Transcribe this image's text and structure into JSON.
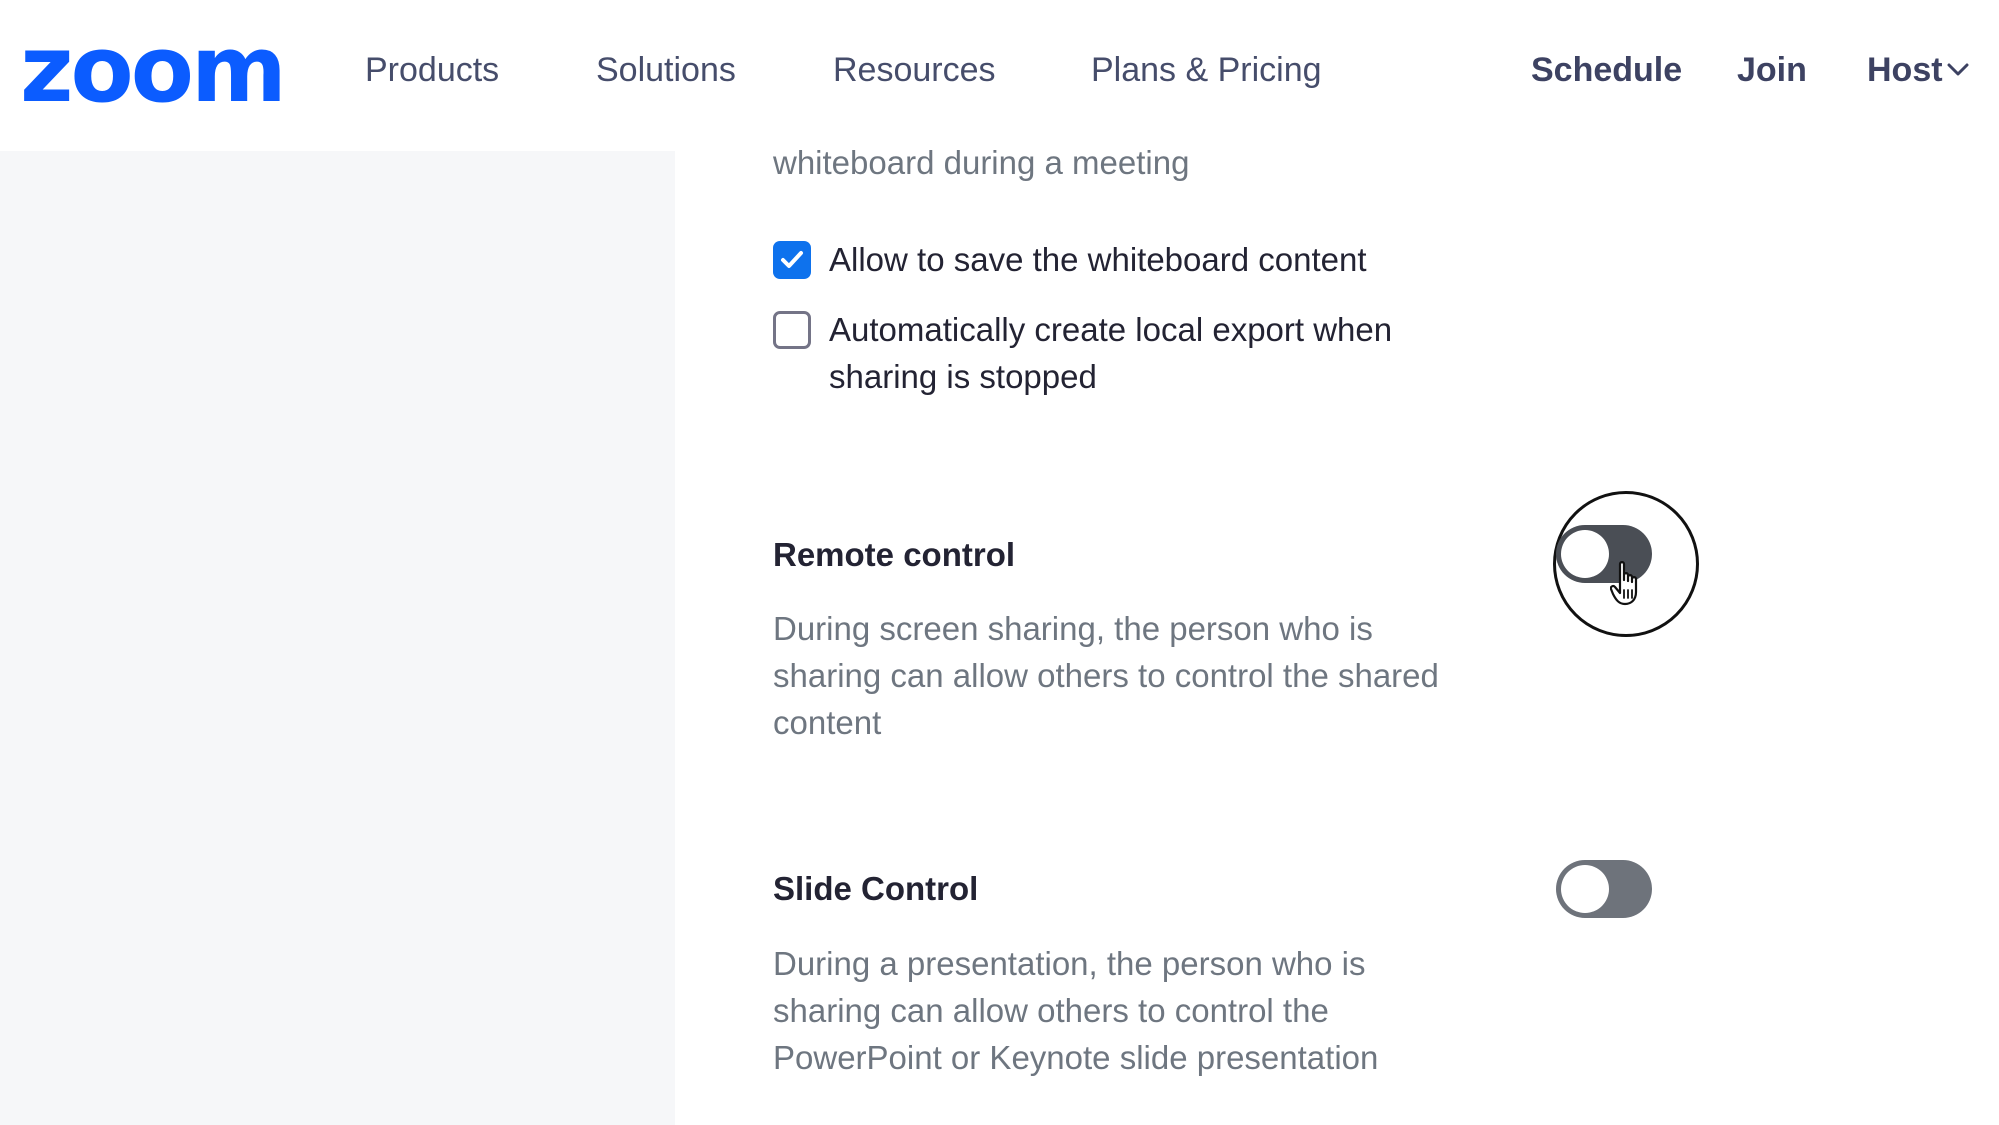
{
  "nav": {
    "logo": "zoom",
    "products": "Products",
    "solutions": "Solutions",
    "resources": "Resources",
    "plans_pricing": "Plans & Pricing",
    "schedule": "Schedule",
    "join": "Join",
    "host": "Host"
  },
  "whiteboard": {
    "partial_description": "whiteboard during a meeting",
    "save_content_label": "Allow to save the whiteboard content",
    "save_content_checked": true,
    "auto_export_label_line1": "Automatically create local export when",
    "auto_export_label_line2": "sharing is stopped",
    "auto_export_checked": false
  },
  "remote_control": {
    "title": "Remote control",
    "description_line1": "During screen sharing, the person who is",
    "description_line2": "sharing can allow others to control the shared",
    "description_line3": "content",
    "enabled": false
  },
  "slide_control": {
    "title": "Slide Control",
    "description_line1": "During a presentation, the person who is",
    "description_line2": "sharing can allow others to control the",
    "description_line3": "PowerPoint or Keynote slide presentation",
    "enabled": false
  },
  "icons": {
    "checkmark": "checkmark-icon",
    "chevron": "chevron-down-icon",
    "cursor": "hand-pointer-icon"
  },
  "colors": {
    "brand": "#0b5cff",
    "checkbox_checked": "#0e72ed",
    "toggle_off": "#4a4e55"
  }
}
